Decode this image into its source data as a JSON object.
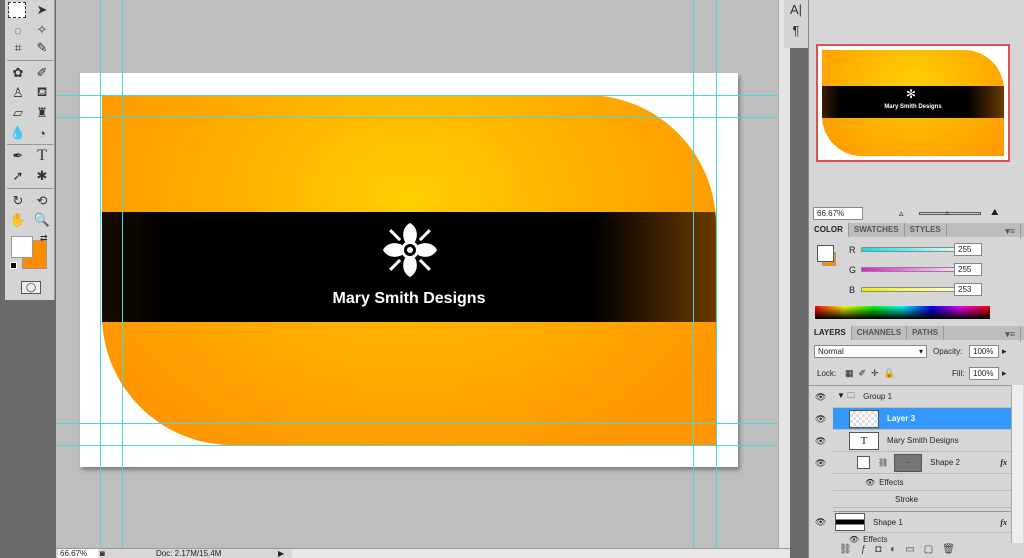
{
  "toolbox": {
    "tools": [
      "rect-marquee",
      "move",
      "lasso",
      "magic-wand",
      "crop",
      "eyedropper",
      "healing",
      "brush",
      "stamp",
      "history-brush",
      "eraser",
      "paint-bucket",
      "blur",
      "dodge",
      "pen",
      "type",
      "path-select",
      "custom-shape",
      "3d-rotate",
      "3d-orbit",
      "hand",
      "zoom"
    ],
    "type_glyph": "T",
    "fg_color": "#ffffff",
    "bg_color": "#ff8c00"
  },
  "document": {
    "brand_text": "Mary Smith Designs",
    "card_colors": {
      "center": "#ffcf00",
      "edge": "#ff9500",
      "band": "#000000"
    }
  },
  "status": {
    "zoom": "66.67%",
    "doc": "Doc: 2.17M/15.4M"
  },
  "mini_panel": {
    "character": "A|",
    "paragraph": "¶"
  },
  "navigator": {
    "zoom": "66.67%",
    "thumb_text": "Mary Smith Designs"
  },
  "color_panel": {
    "tabs": [
      "COLOR",
      "SWATCHES",
      "STYLES"
    ],
    "r_label": "R",
    "g_label": "G",
    "b_label": "B",
    "r": "255",
    "g": "255",
    "b": "253"
  },
  "layers_panel": {
    "tabs": [
      "LAYERS",
      "CHANNELS",
      "PATHS"
    ],
    "blend_mode": "Normal",
    "opacity_label": "Opacity:",
    "opacity": "100%",
    "lock_label": "Lock:",
    "fill_label": "Fill:",
    "fill": "100%",
    "layers": [
      {
        "name": "Group 1"
      },
      {
        "name": "Layer 3",
        "selected": true
      },
      {
        "name": "Mary Smith Designs",
        "thumb": "T"
      },
      {
        "name": "Shape 2",
        "fx": "fx"
      },
      {
        "name": "Effects"
      },
      {
        "name": "Stroke"
      },
      {
        "name": "Shape 1",
        "fx": "fx"
      },
      {
        "name": "Effects"
      }
    ]
  }
}
